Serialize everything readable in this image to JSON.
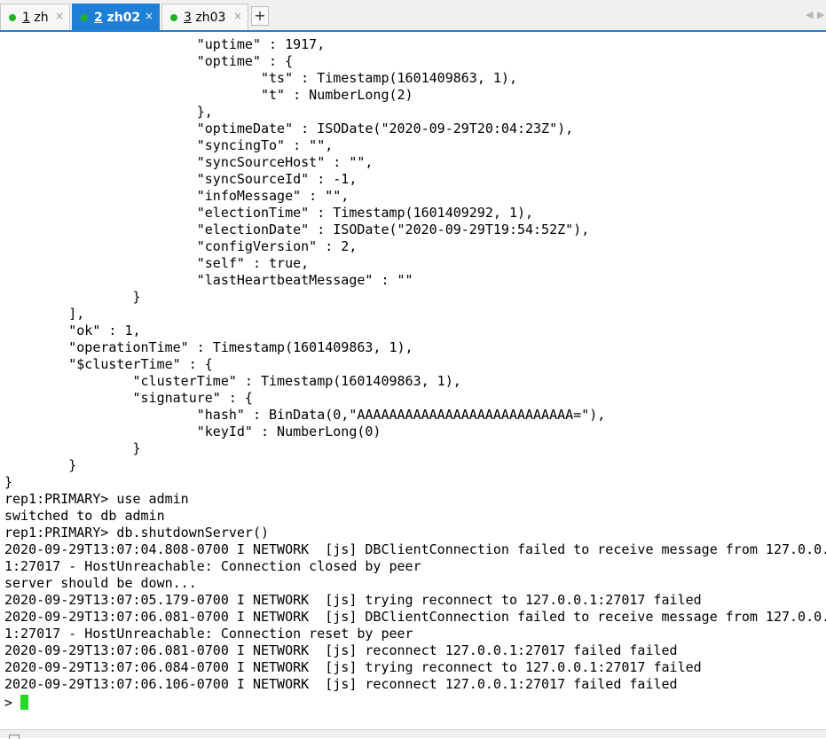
{
  "tabs": [
    {
      "num": "1",
      "label": " zh",
      "active": false
    },
    {
      "num": "2",
      "label": " zh02",
      "active": true
    },
    {
      "num": "3",
      "label": " zh03",
      "active": false
    }
  ],
  "tab_close_glyph": "×",
  "add_tab_glyph": "+",
  "nav_prev_glyph": "◀",
  "nav_next_glyph": "▶",
  "colors": {
    "active_tab": "#1f7fd6",
    "status_dot": "#1fb31f",
    "cursor": "#22dd22"
  },
  "terminal_output": "                        \"uptime\" : 1917,\n                        \"optime\" : {\n                                \"ts\" : Timestamp(1601409863, 1),\n                                \"t\" : NumberLong(2)\n                        },\n                        \"optimeDate\" : ISODate(\"2020-09-29T20:04:23Z\"),\n                        \"syncingTo\" : \"\",\n                        \"syncSourceHost\" : \"\",\n                        \"syncSourceId\" : -1,\n                        \"infoMessage\" : \"\",\n                        \"electionTime\" : Timestamp(1601409292, 1),\n                        \"electionDate\" : ISODate(\"2020-09-29T19:54:52Z\"),\n                        \"configVersion\" : 2,\n                        \"self\" : true,\n                        \"lastHeartbeatMessage\" : \"\"\n                }\n        ],\n        \"ok\" : 1,\n        \"operationTime\" : Timestamp(1601409863, 1),\n        \"$clusterTime\" : {\n                \"clusterTime\" : Timestamp(1601409863, 1),\n                \"signature\" : {\n                        \"hash\" : BinData(0,\"AAAAAAAAAAAAAAAAAAAAAAAAAAA=\"),\n                        \"keyId\" : NumberLong(0)\n                }\n        }\n}\nrep1:PRIMARY> use admin\nswitched to db admin\nrep1:PRIMARY> db.shutdownServer()\n2020-09-29T13:07:04.808-0700 I NETWORK  [js] DBClientConnection failed to receive message from 127.0.0.\n1:27017 - HostUnreachable: Connection closed by peer\nserver should be down...\n2020-09-29T13:07:05.179-0700 I NETWORK  [js] trying reconnect to 127.0.0.1:27017 failed\n2020-09-29T13:07:06.081-0700 I NETWORK  [js] DBClientConnection failed to receive message from 127.0.0.\n1:27017 - HostUnreachable: Connection reset by peer\n2020-09-29T13:07:06.081-0700 I NETWORK  [js] reconnect 127.0.0.1:27017 failed failed\n2020-09-29T13:07:06.084-0700 I NETWORK  [js] trying reconnect to 127.0.0.1:27017 failed\n2020-09-29T13:07:06.106-0700 I NETWORK  [js] reconnect 127.0.0.1:27017 failed failed",
  "prompt_symbol": ">"
}
